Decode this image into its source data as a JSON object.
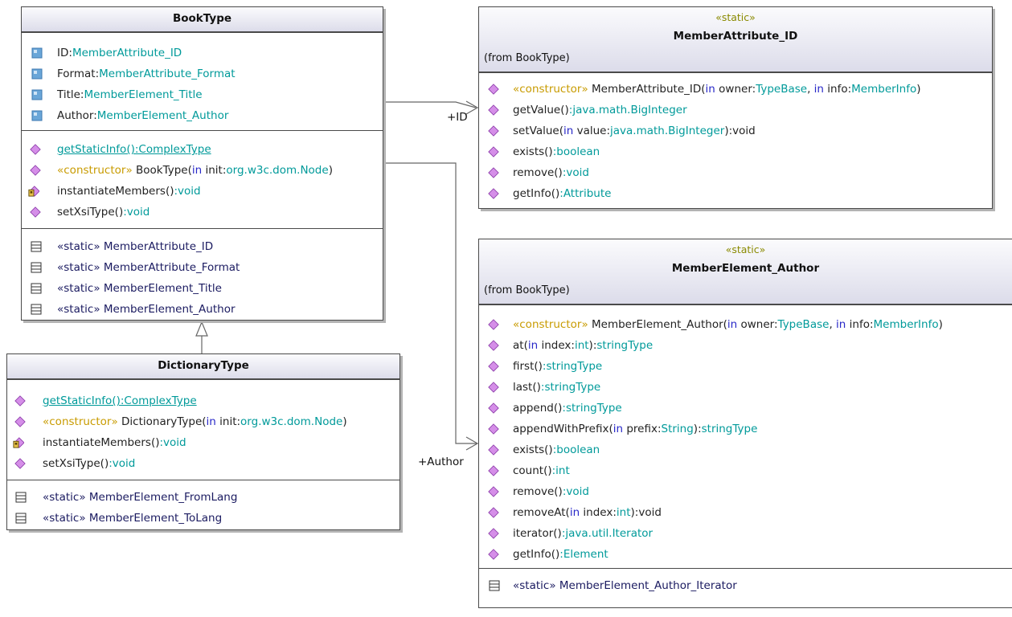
{
  "colors": {
    "keyword": "#2828c8",
    "stereotype": "#c89b00",
    "type": "#009a9a",
    "static_member": "#1a1a60",
    "operation_icon": "#d58ee8",
    "attribute_icon": "#6aa6d8"
  },
  "booktype": {
    "name": "BookType",
    "attributes": [
      {
        "name": "ID:",
        "type": "MemberAttribute_ID",
        "icon": "attribute-icon"
      },
      {
        "name": "Format:",
        "type": "MemberAttribute_Format",
        "icon": "attribute-icon"
      },
      {
        "name": "Title:",
        "type": "MemberElement_Title",
        "icon": "attribute-icon"
      },
      {
        "name": "Author:",
        "type": "MemberElement_Author",
        "icon": "attribute-icon"
      }
    ],
    "operations": {
      "op1": "getStaticInfo():ComplexType",
      "op2_stereo": "«constructor»",
      "op2_name": " BookType(",
      "op2_in": "in",
      "op2_param": " init:",
      "op2_type": "org.w3c.dom.Node",
      "op2_close": ")",
      "op3_name": "instantiateMembers()",
      "op3_type": ":void",
      "op4_name": "setXsiType()",
      "op4_type": ":void"
    },
    "nested": [
      "«static» MemberAttribute_ID",
      "«static» MemberAttribute_Format",
      "«static» MemberElement_Title",
      "«static» MemberElement_Author"
    ]
  },
  "dictionarytype": {
    "name": "DictionaryType",
    "operations": {
      "op1": "getStaticInfo():ComplexType",
      "op2_stereo": "«constructor»",
      "op2_name": " DictionaryType(",
      "op2_in": "in",
      "op2_param": " init:",
      "op2_type": "org.w3c.dom.Node",
      "op2_close": ")",
      "op3_name": "instantiateMembers()",
      "op3_type": ":void",
      "op4_name": "setXsiType()",
      "op4_type": ":void"
    },
    "nested": [
      "«static» MemberElement_FromLang",
      "«static» MemberElement_ToLang"
    ]
  },
  "memberattribute": {
    "stereotype": "«static»",
    "name": "MemberAttribute_ID",
    "from": "(from BookType)",
    "ops": {
      "c_stereo": "«constructor»",
      "c_name": " MemberAttribute_ID(",
      "c_in1": "in",
      "c_p1": " owner:",
      "c_t1": "TypeBase",
      "c_sep": ", ",
      "c_in2": "in",
      "c_p2": " info:",
      "c_t2": "MemberInfo",
      "c_close": ")",
      "o2_name": "getValue()",
      "o2_type": ":java.math.BigInteger",
      "o3_name": "setValue(",
      "o3_in": "in",
      "o3_param": " value:",
      "o3_type": "java.math.BigInteger",
      "o3_close": "):void",
      "o4_name": "exists()",
      "o4_type": ":boolean",
      "o5_name": "remove()",
      "o5_type": ":void",
      "o6_name": "getInfo()",
      "o6_type": ":Attribute"
    }
  },
  "memberelement": {
    "stereotype": "«static»",
    "name": "MemberElement_Author",
    "from": "(from BookType)",
    "ops": {
      "c_stereo": "«constructor»",
      "c_name": " MemberElement_Author(",
      "c_in1": "in",
      "c_p1": " owner:",
      "c_t1": "TypeBase",
      "c_sep": ", ",
      "c_in2": "in",
      "c_p2": " info:",
      "c_t2": "MemberInfo",
      "c_close": ")",
      "at_name": "at(",
      "at_in": "in",
      "at_param": " index:",
      "at_t": "int",
      "at_close": "):",
      "at_type": "stringType",
      "first_name": "first()",
      "first_type": ":stringType",
      "last_name": "last()",
      "last_type": ":stringType",
      "append_name": "append()",
      "append_type": ":stringType",
      "awp_name": "appendWithPrefix(",
      "awp_in": "in",
      "awp_param": " prefix:",
      "awp_t": "String",
      "awp_close": "):",
      "awp_type": "stringType",
      "exists_name": "exists()",
      "exists_type": ":boolean",
      "count_name": "count()",
      "count_type": ":int",
      "remove_name": "remove()",
      "remove_type": ":void",
      "ra_name": "removeAt(",
      "ra_in": "in",
      "ra_param": " index:",
      "ra_t": "int",
      "ra_close": "):void",
      "it_name": "iterator()",
      "it_type": ":java.util.Iterator",
      "gi_name": "getInfo()",
      "gi_type": ":Element"
    },
    "nested": [
      "«static» MemberElement_Author_Iterator"
    ]
  },
  "associations": {
    "id_label": "+ID",
    "author_label": "+Author"
  }
}
